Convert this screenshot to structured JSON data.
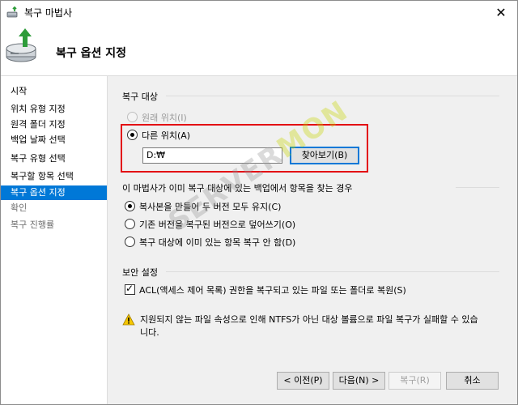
{
  "window": {
    "title": "복구 마법사",
    "close_glyph": "✕"
  },
  "header": {
    "title": "복구 옵션 지정"
  },
  "sidebar": {
    "items": [
      {
        "label": "시작",
        "state": "normal"
      },
      {
        "label": "위치 유형 지정",
        "state": "normal"
      },
      {
        "label": "원격 폴더 지정",
        "state": "normal"
      },
      {
        "label": "백업 날짜 선택",
        "state": "normal"
      },
      {
        "label": "복구 유형 선택",
        "state": "normal"
      },
      {
        "label": "복구할 항목 선택",
        "state": "normal"
      },
      {
        "label": "복구 옵션 지정",
        "state": "active"
      },
      {
        "label": "확인",
        "state": "disabled"
      },
      {
        "label": "복구 진행률",
        "state": "disabled"
      }
    ]
  },
  "recovery_target": {
    "group_title": "복구 대상",
    "original_location_label": "원래 위치(I)",
    "other_location_label": "다른 위치(A)",
    "path_value": "D:₩",
    "browse_label": "찾아보기(B)"
  },
  "conflict": {
    "group_title": "이 마법사가 이미 복구 대상에 있는 백업에서 항목을 찾는 경우",
    "options": [
      {
        "label": "복사본을 만들어 두 버전 모두 유지(C)",
        "checked": true
      },
      {
        "label": "기존 버전을 복구된 버전으로 덮어쓰기(O)",
        "checked": false
      },
      {
        "label": "복구 대상에 이미 있는 항목 복구 안 함(D)",
        "checked": false
      }
    ]
  },
  "security": {
    "group_title": "보안 설정",
    "acl_label": "ACL(액세스 제어 목록) 권한을 복구되고 있는 파일 또는 폴더로 복원(S)",
    "acl_checked": true
  },
  "warning": {
    "text": "지원되지 않는 파일 속성으로 인해 NTFS가 아닌 대상 볼륨으로 파일 복구가 실패할 수 있습니다."
  },
  "footer": {
    "prev_label": "< 이전(P)",
    "next_label": "다음(N) >",
    "recover_label": "복구(R)",
    "cancel_label": "취소"
  },
  "watermark": {
    "part1": "SERVER",
    "part2": "MON"
  },
  "colors": {
    "accent": "#0078d7",
    "highlight": "#e30613",
    "watermark_green": "#c7d600"
  }
}
